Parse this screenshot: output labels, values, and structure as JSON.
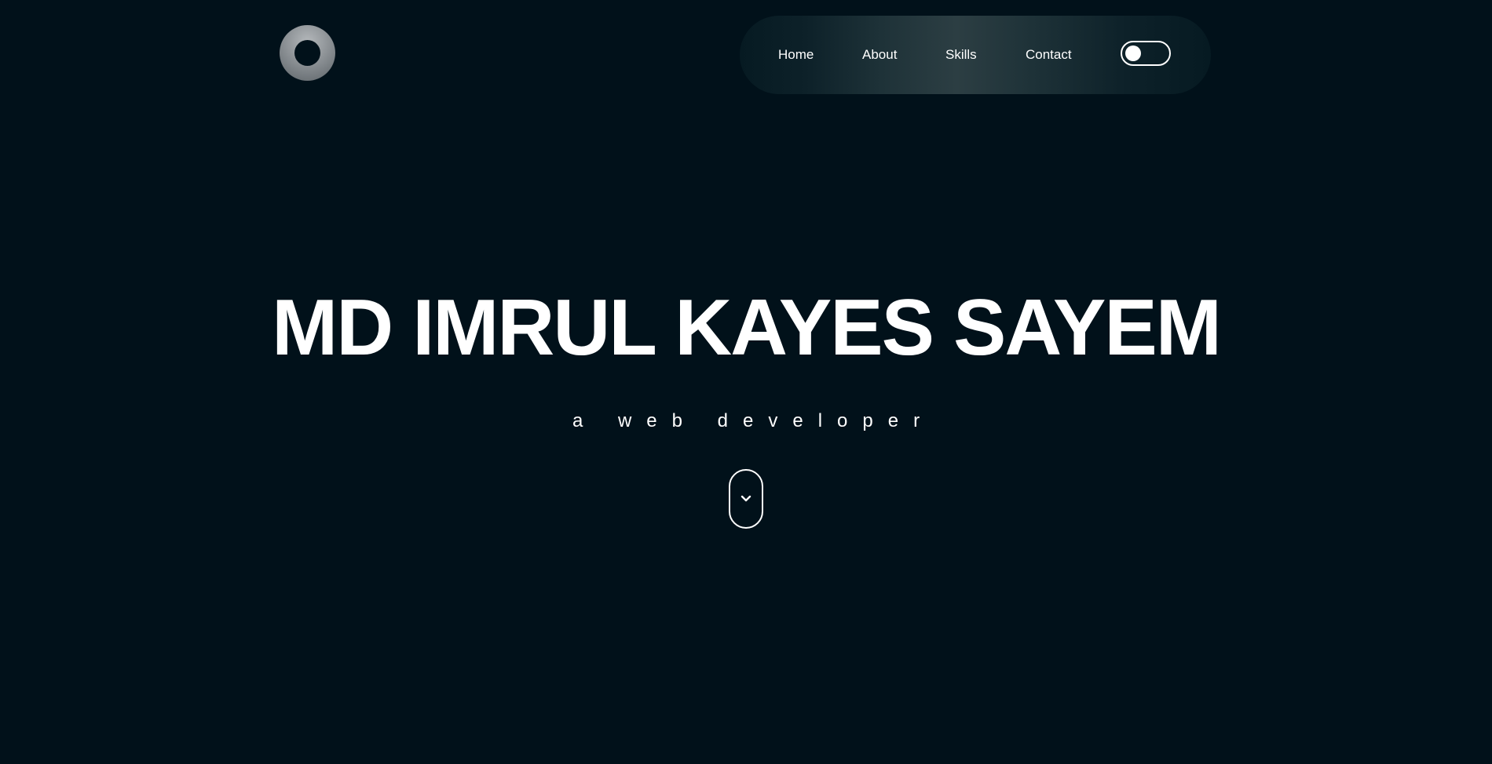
{
  "nav": {
    "items": [
      {
        "label": "Home"
      },
      {
        "label": "About"
      },
      {
        "label": "Skills"
      },
      {
        "label": "Contact"
      }
    ],
    "theme_toggle": {
      "state": "off"
    }
  },
  "hero": {
    "title": "MD IMRUL KAYES SAYEM",
    "subtitle": "a web developer"
  },
  "icons": {
    "logo": "ring-logo-icon",
    "scroll": "chevron-down-icon"
  },
  "colors": {
    "background": "#01111a",
    "text": "#ffffff",
    "navbar_highlight": "#2c3e43",
    "logo": "#8d9296"
  }
}
